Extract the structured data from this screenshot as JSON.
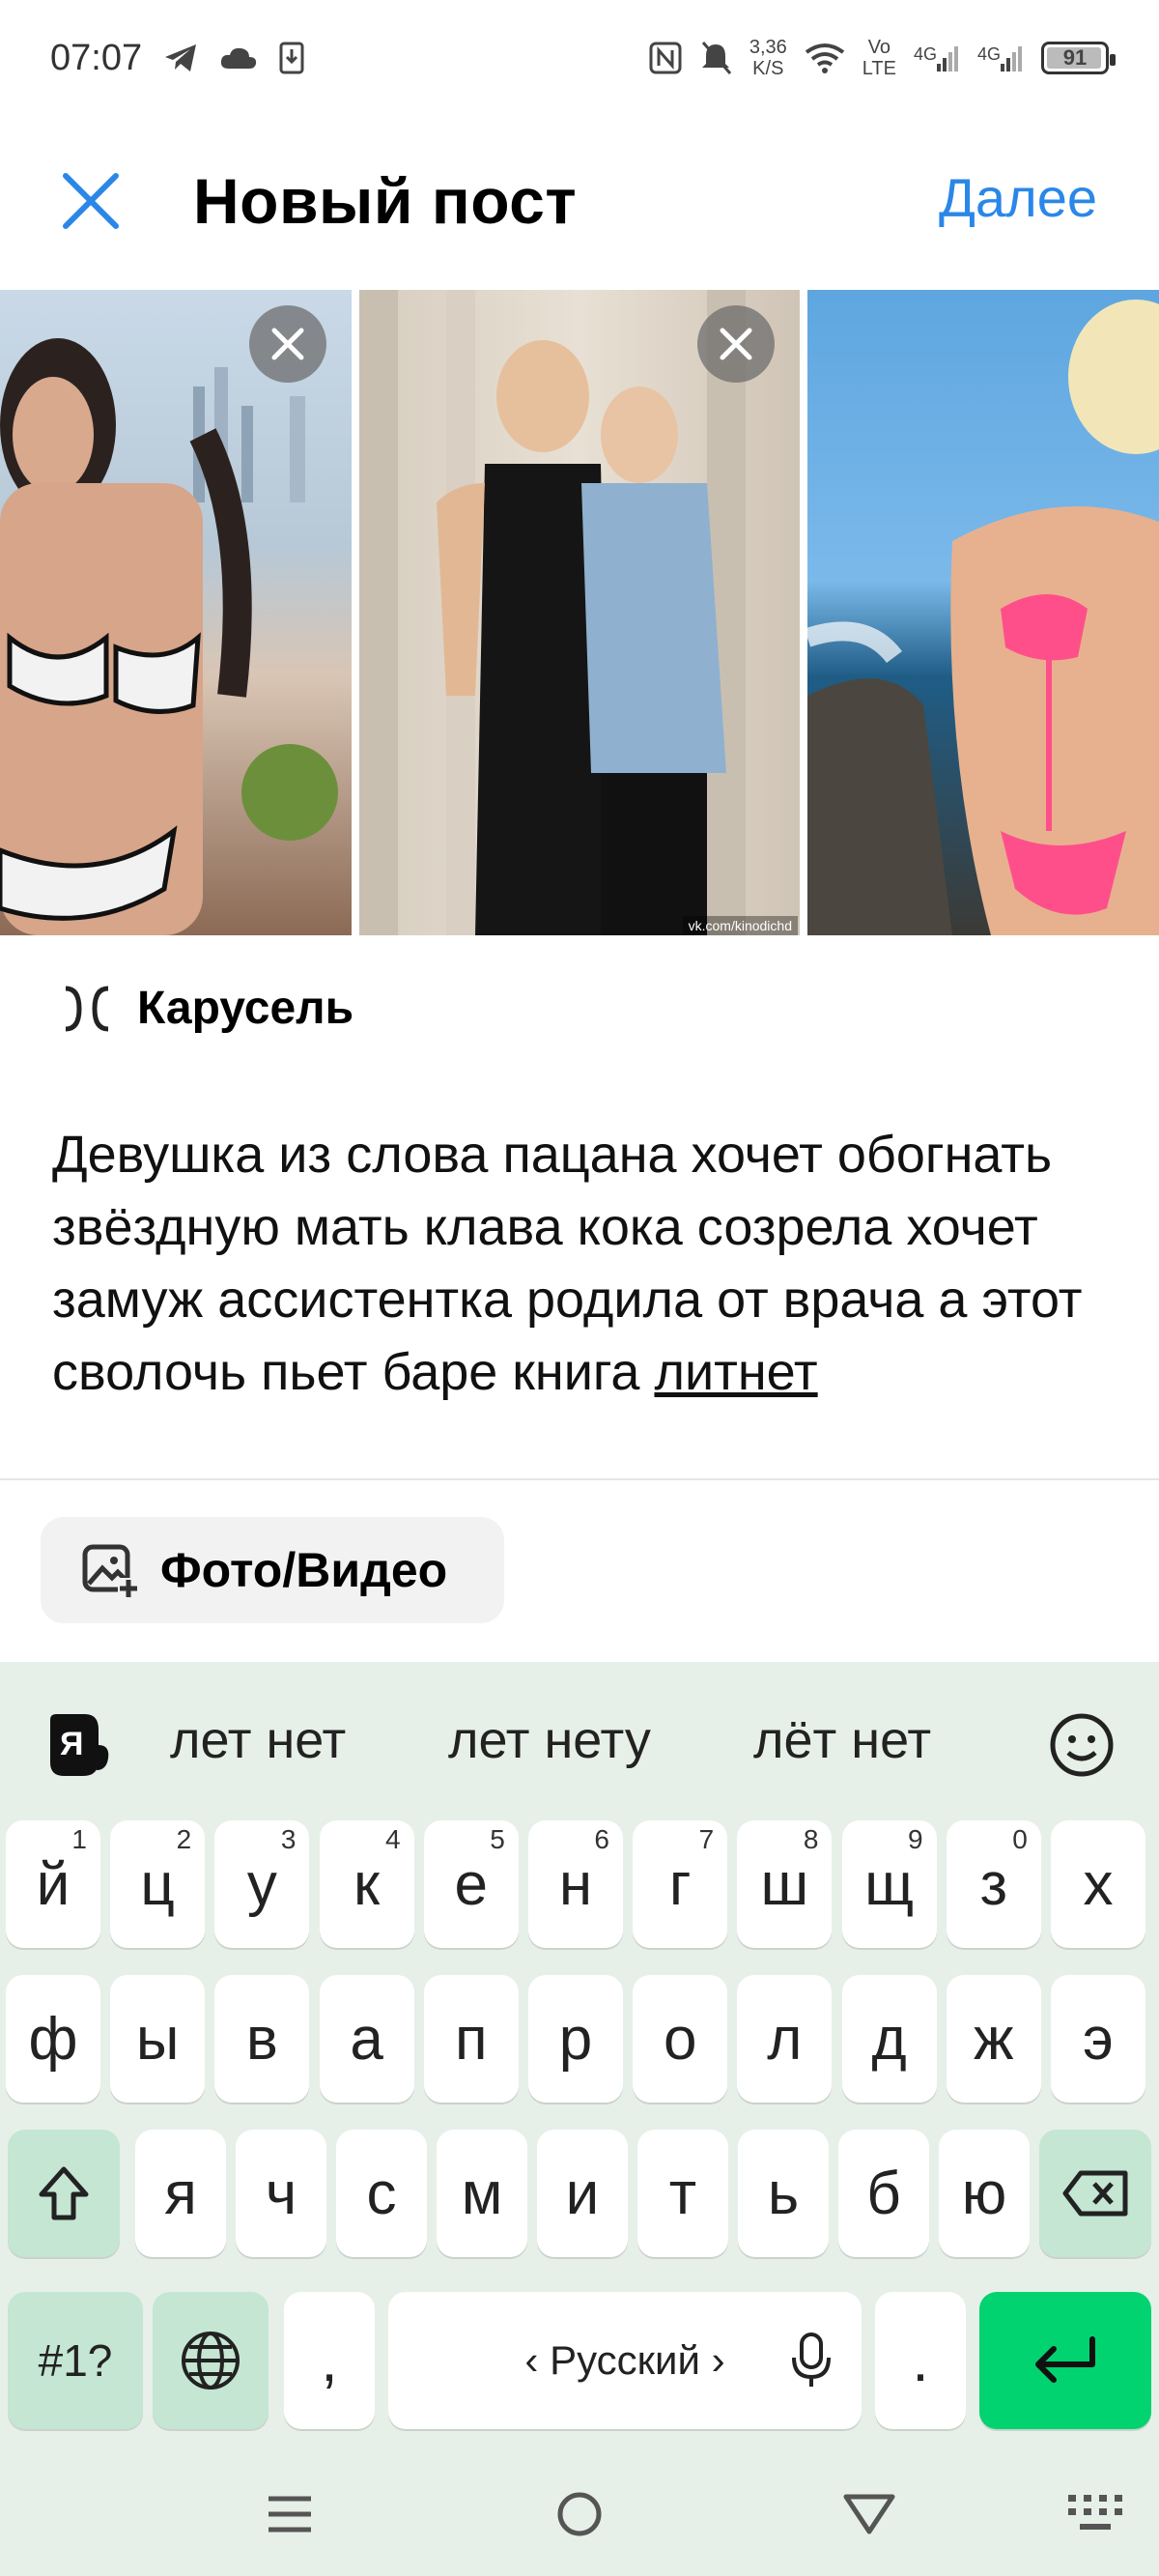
{
  "status": {
    "time": "07:07",
    "net_speed_value": "3,36",
    "net_speed_unit": "K/S",
    "volte_top": "Vo",
    "volte_bottom": "LTE",
    "sig1_label": "4G",
    "sig2_label": "4G",
    "battery": "91"
  },
  "header": {
    "title": "Новый пост",
    "next_label": "Далее"
  },
  "carousel": {
    "watermark": "vk.com/kinodichd",
    "label": "Карусель"
  },
  "post": {
    "text": "Девушка из слова пацана хочет обогнать звёздную мать клава кока созрела хочет замуж ассистентка родила от врача а этот сволочь пьет баре книга ",
    "link_word": "литнет"
  },
  "media": {
    "label": "Фото/Видео"
  },
  "keyboard": {
    "suggestions": [
      "лет нет",
      "лет нету",
      "лёт нет"
    ],
    "row1": [
      "й",
      "ц",
      "у",
      "к",
      "е",
      "н",
      "г",
      "ш",
      "щ",
      "з",
      "х"
    ],
    "row1_hints": [
      "1",
      "2",
      "3",
      "4",
      "5",
      "6",
      "7",
      "8",
      "9",
      "0",
      ""
    ],
    "row2": [
      "ф",
      "ы",
      "в",
      "а",
      "п",
      "р",
      "о",
      "л",
      "д",
      "ж",
      "э"
    ],
    "row3": [
      "я",
      "ч",
      "с",
      "м",
      "и",
      "т",
      "ь",
      "б",
      "ю"
    ],
    "symbols_label": "#1?",
    "comma": ",",
    "space_label": "‹ Русский ›",
    "period": "."
  },
  "colors": {
    "accent": "#2a87e8",
    "enter_key": "#00d36f",
    "keyboard_bg": "#e6f0e8",
    "func_key": "#c4e6d2"
  }
}
